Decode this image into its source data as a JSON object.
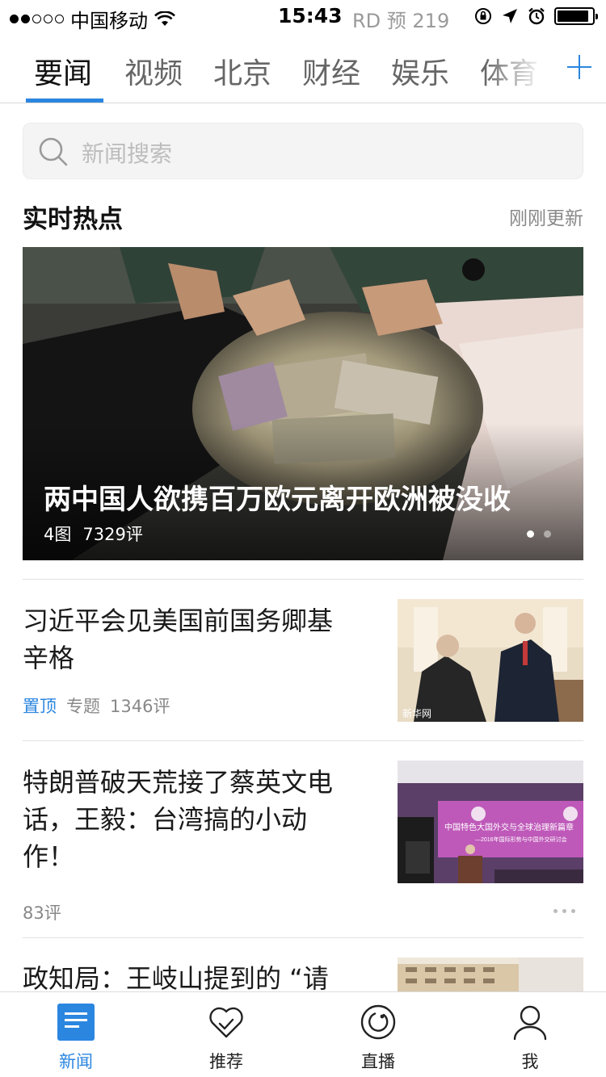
{
  "status_bar": {
    "carrier": "中国移动",
    "time": "15:43",
    "rd_label": "RD 预 219"
  },
  "tabs": [
    {
      "label": "要闻",
      "active": true
    },
    {
      "label": "视频"
    },
    {
      "label": "北京"
    },
    {
      "label": "财经"
    },
    {
      "label": "娱乐"
    },
    {
      "label": "体育"
    }
  ],
  "search": {
    "placeholder": "新闻搜索"
  },
  "section": {
    "title": "实时热点",
    "meta": "刚刚更新"
  },
  "hero": {
    "title": "两中国人欲携百万欧元离开欧洲被没收",
    "images": "4图",
    "comments": "7329评",
    "slides": 2,
    "active_slide": 1
  },
  "news": [
    {
      "title_line1": "习近平会见美国前国务卿基",
      "title_line2": "辛格",
      "tag": "置顶",
      "type": "专题",
      "comments": "1346评",
      "thumb_watermark": "新华网"
    },
    {
      "title_line1": "特朗普破天荒接了蔡英文电",
      "title_line2": "话，王毅：台湾搞的小动",
      "title_line3": "作！",
      "comments": "83评",
      "thumb_banner": "中国特色大国外交与全球治理新篇章",
      "thumb_banner_sub": "—2016年国际形势与中国外交研讨会"
    },
    {
      "title_line1": "政知局：王岐山提到的 “请"
    }
  ],
  "bottom_nav": [
    {
      "label": "新闻",
      "icon": "news-icon",
      "active": true
    },
    {
      "label": "推荐",
      "icon": "heart-check-icon"
    },
    {
      "label": "直播",
      "icon": "live-icon"
    },
    {
      "label": "我",
      "icon": "person-icon"
    }
  ],
  "colors": {
    "accent": "#2b86e0"
  }
}
